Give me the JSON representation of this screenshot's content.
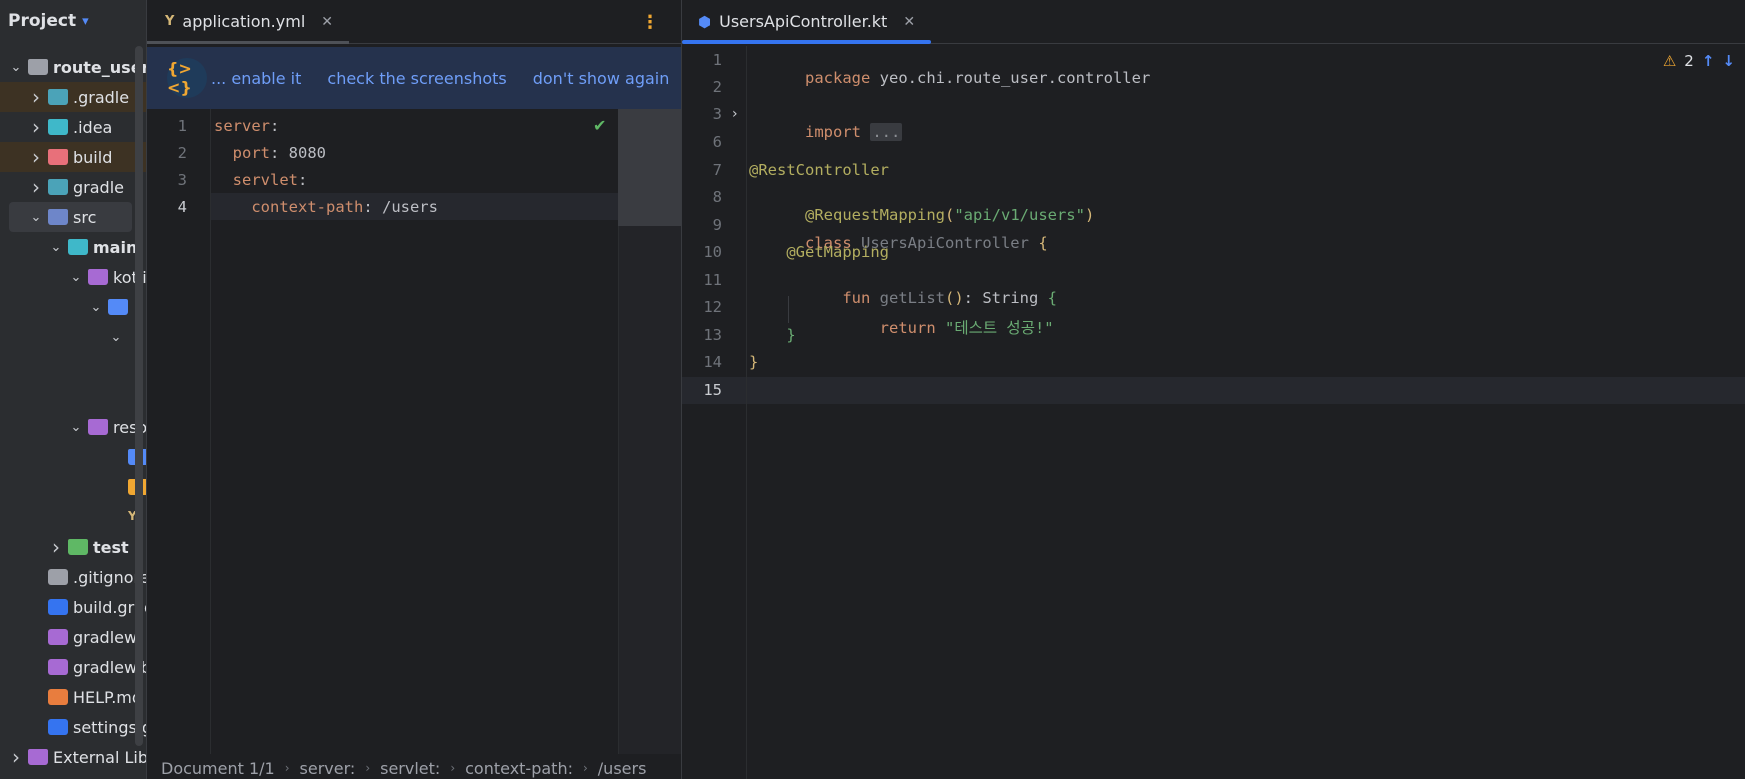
{
  "project_panel": {
    "title": "Project",
    "items": [
      {
        "label": "route_user",
        "depth": 0,
        "arrow": "down",
        "icon": "folder-icon",
        "color": "#9da0a8",
        "bold": true
      },
      {
        "label": ".gradle",
        "depth": 1,
        "arrow": "right",
        "icon": "gradle-folder-icon",
        "color": "#4ba3b8",
        "highlight": true
      },
      {
        "label": ".idea",
        "depth": 1,
        "arrow": "right",
        "icon": "idea-folder-icon",
        "color": "#3fb8c9"
      },
      {
        "label": "build",
        "depth": 1,
        "arrow": "right",
        "icon": "build-folder-icon",
        "color": "#e8707a",
        "highlight": true
      },
      {
        "label": "gradle",
        "depth": 1,
        "arrow": "right",
        "icon": "gradle-folder-icon",
        "color": "#4ba3b8"
      },
      {
        "label": "src",
        "depth": 1,
        "arrow": "down",
        "icon": "source-folder-icon",
        "color": "#6e86c9",
        "selected": true
      },
      {
        "label": "main",
        "depth": 2,
        "arrow": "down",
        "icon": "folder-icon",
        "color": "#3fb8c9",
        "bold": true
      },
      {
        "label": "kotlin",
        "depth": 3,
        "arrow": "down",
        "icon": "kotlin-folder-icon",
        "color": "#a76ad3"
      },
      {
        "label": "",
        "depth": 4,
        "arrow": "down",
        "icon": "package-icon",
        "color": "#548af7"
      },
      {
        "label": "",
        "depth": 5,
        "arrow": "down",
        "icon": "",
        "color": ""
      },
      {
        "label": "",
        "depth": 0,
        "arrow": "",
        "icon": "",
        "color": ""
      },
      {
        "label": "",
        "depth": 0,
        "arrow": "",
        "icon": "",
        "color": ""
      },
      {
        "label": "resources",
        "depth": 3,
        "arrow": "down",
        "icon": "resources-folder-icon",
        "color": "#a76ad3"
      },
      {
        "label": "",
        "depth": 5,
        "arrow": "",
        "icon": "web-folder-icon",
        "color": "#548af7"
      },
      {
        "label": "",
        "depth": 5,
        "arrow": "",
        "icon": "db-folder-icon",
        "color": "#f0a732"
      },
      {
        "label": "",
        "depth": 5,
        "arrow": "",
        "icon": "yaml-file-icon",
        "color": "#d5b778"
      },
      {
        "label": "test",
        "depth": 2,
        "arrow": "right",
        "icon": "test-folder-icon",
        "color": "#5fb865",
        "bold": true
      },
      {
        "label": ".gitignore",
        "depth": 1,
        "arrow": "",
        "icon": "git-icon",
        "color": "#9da0a8"
      },
      {
        "label": "build.gradle.kts",
        "depth": 1,
        "arrow": "",
        "icon": "gradle-file-icon",
        "color": "#3574f0"
      },
      {
        "label": "gradlew",
        "depth": 1,
        "arrow": "",
        "icon": "gradle-file-icon",
        "color": "#a76ad3"
      },
      {
        "label": "gradlew.bat",
        "depth": 1,
        "arrow": "",
        "icon": "gradle-file-icon",
        "color": "#a76ad3"
      },
      {
        "label": "HELP.md",
        "depth": 1,
        "arrow": "",
        "icon": "markdown-icon",
        "color": "#e87d3e"
      },
      {
        "label": "settings.gradle.kts",
        "depth": 1,
        "arrow": "",
        "icon": "gradle-file-icon",
        "color": "#3574f0"
      },
      {
        "label": "External Libraries",
        "depth": 0,
        "arrow": "right",
        "icon": "library-icon",
        "color": "#a76ad3"
      }
    ]
  },
  "left_editor": {
    "tab_label": "application.yml",
    "banner": {
      "logo": "{><}",
      "link_enable": "... enable it",
      "link_screens": "check the screenshots",
      "link_dismiss": "don't show again"
    },
    "lines": [
      {
        "num": "1",
        "key": "server",
        "sep": ":",
        "val": ""
      },
      {
        "num": "2",
        "key": "  port",
        "sep": ": ",
        "val": "8080"
      },
      {
        "num": "3",
        "key": "  servlet",
        "sep": ":",
        "val": ""
      },
      {
        "num": "4",
        "key": "    context-path",
        "sep": ": ",
        "val": "/users"
      }
    ],
    "breadcrumbs": [
      "Document 1/1",
      "server:",
      "servlet:",
      "context-path:",
      "/users"
    ]
  },
  "right_editor": {
    "tab_label": "UsersApiController.kt",
    "warnings": "2",
    "line_numbers": [
      "1",
      "2",
      "3",
      "6",
      "7",
      "8",
      "9",
      "10",
      "11",
      "12",
      "13",
      "14",
      "15"
    ],
    "code": {
      "l1_kw": "package",
      "l1_rest": " yeo.chi.route_user.controller",
      "l3_kw": "import",
      "l3_fold": "...",
      "l7": "@RestController",
      "l8_ann": "@RequestMapping",
      "l8_open": "(",
      "l8_str": "\"api/v1/users\"",
      "l8_close": ")",
      "l9_kw": "class",
      "l9_name": " UsersApiController ",
      "l9_brace": "{",
      "l10": "    @GetMapping",
      "l11_kw": "    fun",
      "l11_name": " getList",
      "l11_parens": "()",
      "l11_rest": ": String ",
      "l11_brace": "{",
      "l12_kw": "        return",
      "l12_str": " \"테스트 성공!\"",
      "l13": "    }",
      "l14": "}"
    }
  }
}
